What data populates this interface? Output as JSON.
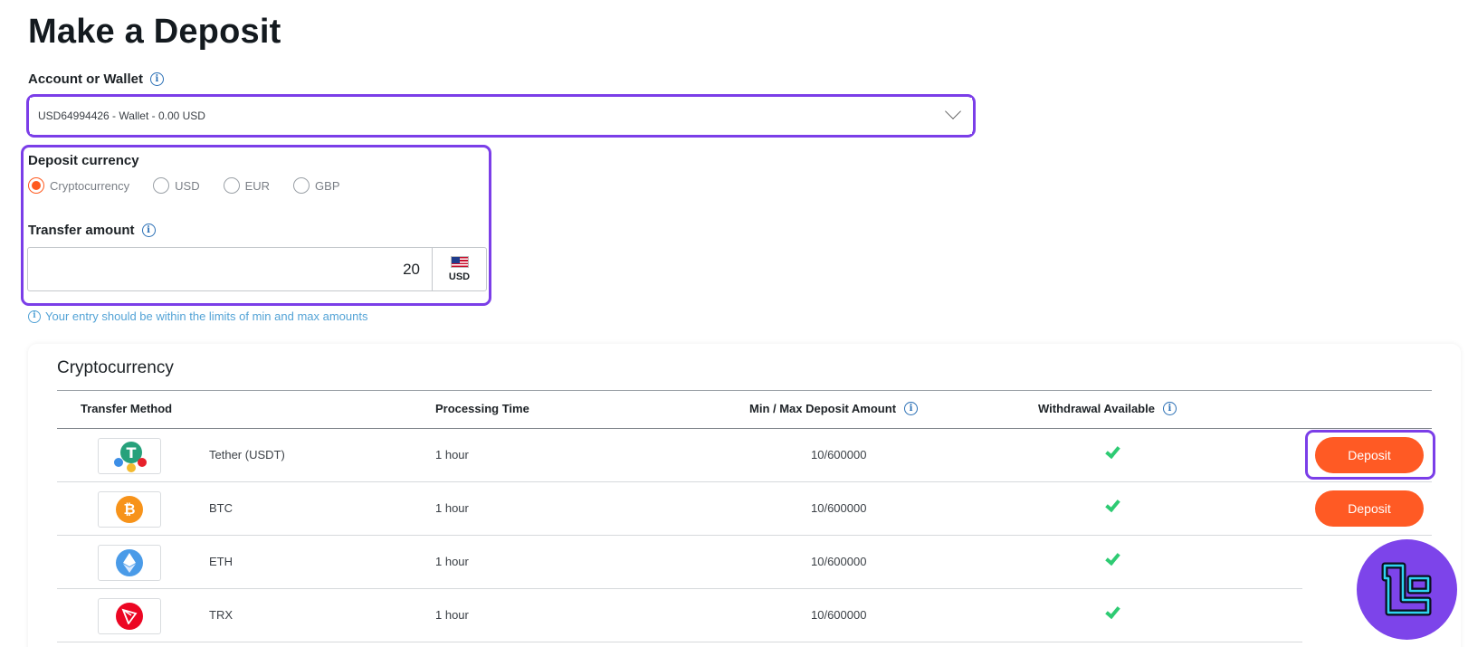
{
  "page": {
    "title": "Make a Deposit"
  },
  "account": {
    "label": "Account or Wallet",
    "selected": "USD64994426 - Wallet - 0.00 USD"
  },
  "deposit_currency": {
    "label": "Deposit currency",
    "options": [
      "Cryptocurrency",
      "USD",
      "EUR",
      "GBP"
    ],
    "selected": "Cryptocurrency"
  },
  "transfer": {
    "label": "Transfer amount",
    "amount": "20",
    "currency": "USD",
    "hint": "Your entry should be within the limits of min and max amounts"
  },
  "table": {
    "title": "Cryptocurrency",
    "columns": {
      "method": "Transfer Method",
      "processing": "Processing Time",
      "limits": "Min / Max Deposit Amount",
      "withdrawal": "Withdrawal Available"
    },
    "rows": [
      {
        "name": "Tether (USDT)",
        "icon": "tether-icon",
        "processing": "1 hour",
        "limits": "10/600000",
        "withdrawal": true,
        "button": "Deposit"
      },
      {
        "name": "BTC",
        "icon": "bitcoin-icon",
        "processing": "1 hour",
        "limits": "10/600000",
        "withdrawal": true,
        "button": "Deposit"
      },
      {
        "name": "ETH",
        "icon": "ethereum-icon",
        "processing": "1 hour",
        "limits": "10/600000",
        "withdrawal": true,
        "button": ""
      },
      {
        "name": "TRX",
        "icon": "tron-icon",
        "processing": "1 hour",
        "limits": "10/600000",
        "withdrawal": true,
        "button": ""
      }
    ]
  },
  "colors": {
    "accent": "#ff5a24",
    "highlight": "#7b3ee8",
    "check": "#2ecb73",
    "hint": "#53a3d6"
  }
}
